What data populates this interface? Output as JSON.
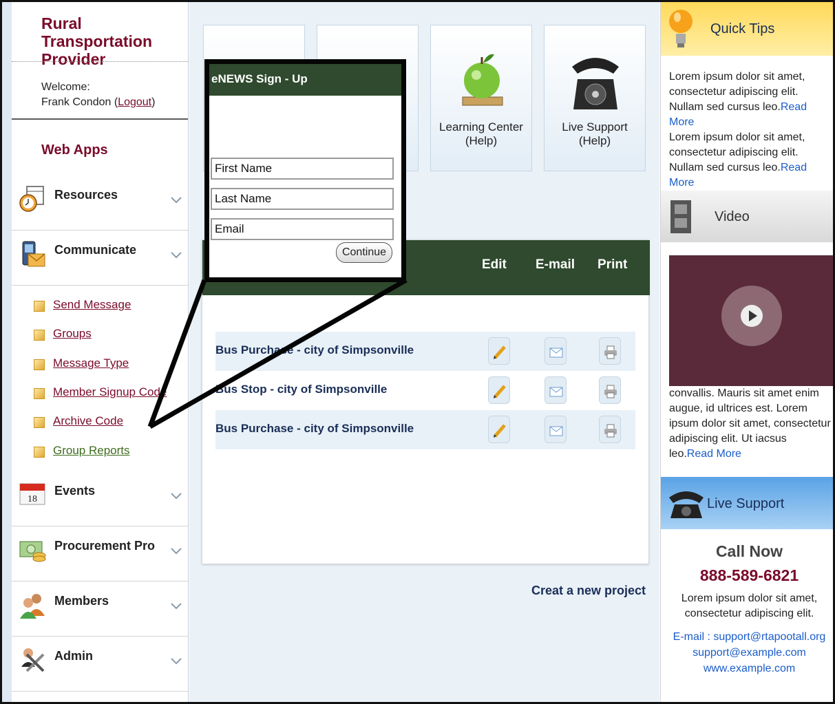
{
  "brand": {
    "title": "Rural Transportation Provider"
  },
  "user": {
    "welcome_label": "Welcome:",
    "name": "Frank Condon",
    "logout": "Logout"
  },
  "sidebar": {
    "section_title": "Web Apps",
    "items": [
      {
        "label": "Resources",
        "icon": "stopwatch-calendar-icon"
      },
      {
        "label": "Communicate",
        "icon": "phone-envelope-icon"
      },
      {
        "label": "Events",
        "icon": "calendar-icon",
        "icon_text": "18"
      },
      {
        "label": "Procurement Pro",
        "icon": "money-icon"
      },
      {
        "label": "Members",
        "icon": "users-icon"
      },
      {
        "label": "Admin",
        "icon": "tools-icon"
      }
    ],
    "submenu": [
      {
        "label": "Send Message"
      },
      {
        "label": "Groups"
      },
      {
        "label": "Message Type"
      },
      {
        "label": "Member Signup Code"
      },
      {
        "label": "Archive Code"
      },
      {
        "label": "Group Reports"
      }
    ]
  },
  "tiles": [
    {
      "label": "",
      "icon": "briefcase-icon"
    },
    {
      "label": "",
      "icon": "box-icon"
    },
    {
      "label": "Learning Center\n(Help)",
      "icon": "apple-icon"
    },
    {
      "label": "Live Support\n(Help)",
      "icon": "telephone-icon"
    }
  ],
  "projects": {
    "columns": {
      "edit": "Edit",
      "email": "E-mail",
      "print": "Print"
    },
    "rows": [
      {
        "name": "Bus Purchase - city of Simpsonville"
      },
      {
        "name": "Bus Stop - city of Simpsonville"
      },
      {
        "name": "Bus Purchase - city of Simpsonville"
      }
    ],
    "create_link": "Creat a new project"
  },
  "popup": {
    "title": "eNEWS Sign - Up",
    "first_name": "First Name",
    "last_name": "Last Name",
    "email": "Email",
    "continue": "Continue"
  },
  "right": {
    "quick_tips": {
      "title": "Quick Tips",
      "tips": [
        {
          "text": "Lorem ipsum dolor sit amet, consectetur adipiscing elit. Nullam sed cursus leo.",
          "link": "Read More"
        },
        {
          "text": "Lorem ipsum dolor sit amet, consectetur adipiscing elit. Nullam sed cursus leo.",
          "link": "Read More"
        }
      ]
    },
    "video": {
      "title": "Video",
      "text": "convallis. Mauris sit amet enim augue, id ultrices est. Lorem ipsum dolor sit amet, consectetur adipiscing elit. Ut iacsus leo.",
      "link": "Read More"
    },
    "live_support": {
      "title": "Live Support",
      "call_now": "Call Now",
      "phone": "888-589-6821",
      "text": "Lorem ipsum dolor sit amet, consectetur adipiscing elit.",
      "email_line": "E-mail : support@rtapootall.org",
      "email2": "support@example.com",
      "website": "www.example.com"
    }
  },
  "colors": {
    "brand": "#7a0b2b",
    "header_green": "#2f4a2e",
    "link_blue": "#1a5cc9",
    "navy": "#1a2e57"
  }
}
